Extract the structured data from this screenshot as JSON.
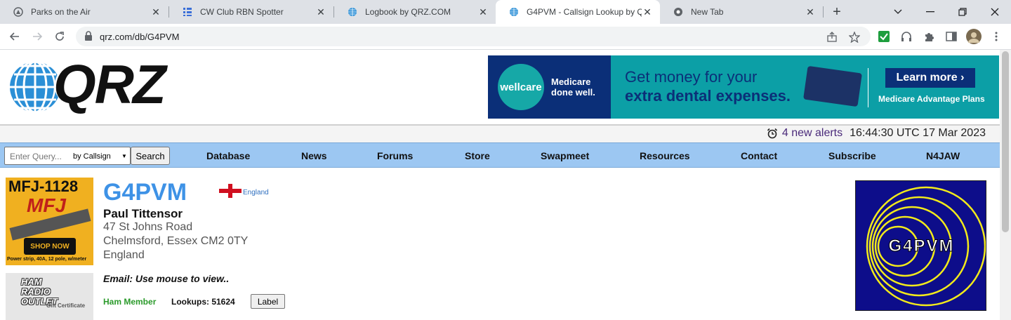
{
  "browser": {
    "tabs": [
      {
        "title": "Parks on the Air",
        "icon": "pota-icon"
      },
      {
        "title": "CW Club RBN Spotter",
        "icon": "grid-icon"
      },
      {
        "title": "Logbook by QRZ.COM",
        "icon": "globe-icon"
      },
      {
        "title": "G4PVM - Callsign Lookup by QRZ Ham Radio",
        "icon": "globe-icon",
        "active": true
      },
      {
        "title": "New Tab",
        "icon": "chrome-icon"
      }
    ],
    "new_tab": "+",
    "url": "qrz.com/db/G4PVM",
    "colors": {
      "tabstrip": "#dee1e6",
      "omnibox": "#f1f3f4"
    }
  },
  "site": {
    "logo_text": "QRZ",
    "ad": {
      "brand": "wellcare",
      "tagline": "Medicare\ndone well.",
      "headline1": "Get money for your",
      "headline2": "extra dental expenses.",
      "cta": "Learn more ›",
      "sub": "Medicare Advantage Plans"
    },
    "alerts": {
      "link": "4 new alerts",
      "clock": "16:44:30 UTC 17 Mar 2023"
    },
    "search": {
      "placeholder": "Enter Query...",
      "mode": "by Callsign",
      "button": "Search"
    },
    "menu": [
      "Database",
      "News",
      "Forums",
      "Store",
      "Swapmeet",
      "Resources",
      "Contact",
      "Subscribe",
      "N4JAW"
    ],
    "colors": {
      "navbar": "#9cc7f2",
      "callsign": "#3e92e6",
      "member": "#2a9a2a"
    }
  },
  "side_ads": {
    "mfj": {
      "model": "MFJ-1128",
      "brand": "MFJ",
      "cta": "SHOP NOW",
      "desc": "Power strip, 40A, 12 pole, w/meter"
    },
    "hro": {
      "text": "HAM\nRADIO\nOUTLET",
      "sub": "Gift Certificate"
    }
  },
  "profile": {
    "callsign": "G4PVM",
    "country": "England",
    "name": "Paul Tittensor",
    "address": [
      "47 St Johns Road",
      "Chelmsford, Essex CM2 0TY",
      "England"
    ],
    "email": "Email: Use mouse to view..",
    "member": "Ham Member",
    "lookups": "Lookups: 51624",
    "label_button": "Label",
    "qsl_text": "G4PVM"
  }
}
